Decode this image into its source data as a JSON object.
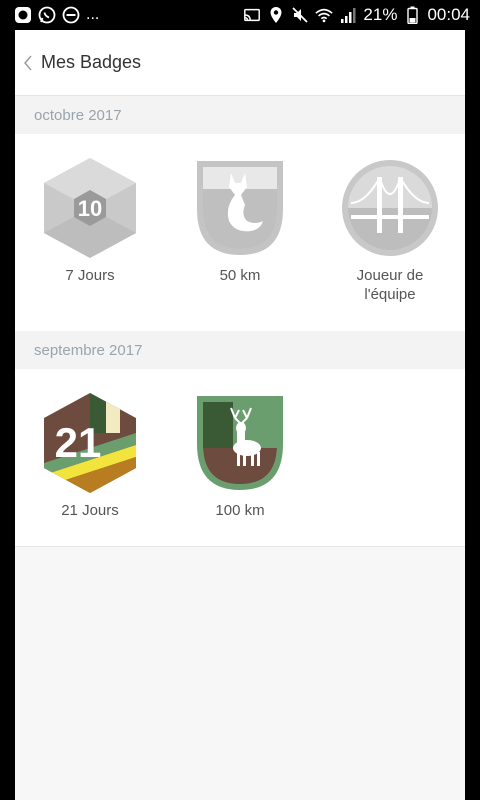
{
  "statusbar": {
    "more": "...",
    "battery_pct": "21%",
    "time": "00:04"
  },
  "header": {
    "title": "Mes Badges"
  },
  "sections": [
    {
      "title": "octobre 2017",
      "badges": [
        {
          "label": "7 Jours",
          "number": "10"
        },
        {
          "label": "50 km"
        },
        {
          "label": "Joueur de l'équipe"
        }
      ]
    },
    {
      "title": "septembre 2017",
      "badges": [
        {
          "label": "21 Jours",
          "number": "21"
        },
        {
          "label": "100 km"
        }
      ]
    }
  ],
  "colors": {
    "gray_light": "#d9d9d9",
    "gray_mid": "#c4c4c4",
    "gray_dark": "#a9a9a9",
    "brown": "#6d4b3e",
    "green": "#6b9e6e",
    "dark_green": "#3a5a36",
    "yellow": "#f2e33d",
    "mustard": "#b77d20"
  }
}
